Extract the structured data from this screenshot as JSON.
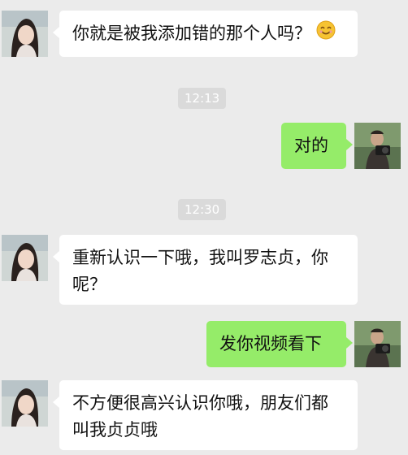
{
  "conversation": {
    "messages": [
      {
        "sender": "contact",
        "text": "你就是被我添加错的那个人吗？",
        "emoji": "smiling-face"
      },
      {
        "type": "timestamp",
        "text": "12:13"
      },
      {
        "sender": "me",
        "text": "对的"
      },
      {
        "type": "timestamp",
        "text": "12:30"
      },
      {
        "sender": "contact",
        "text": "重新认识一下哦，我叫罗志贞，你呢？"
      },
      {
        "sender": "me",
        "text": "发你视频看下"
      },
      {
        "sender": "contact",
        "text": "不方便很高兴认识你哦，朋友们都叫我贞贞哦"
      }
    ]
  },
  "colors": {
    "background": "#ebebeb",
    "incoming_bubble": "#ffffff",
    "outgoing_bubble": "#95ec69",
    "timestamp_bg": "#dadada"
  },
  "icons": {
    "contact_avatar": "woman-portrait-avatar",
    "me_avatar": "man-with-camera-avatar",
    "emoji": "smiling-face-emoji"
  }
}
